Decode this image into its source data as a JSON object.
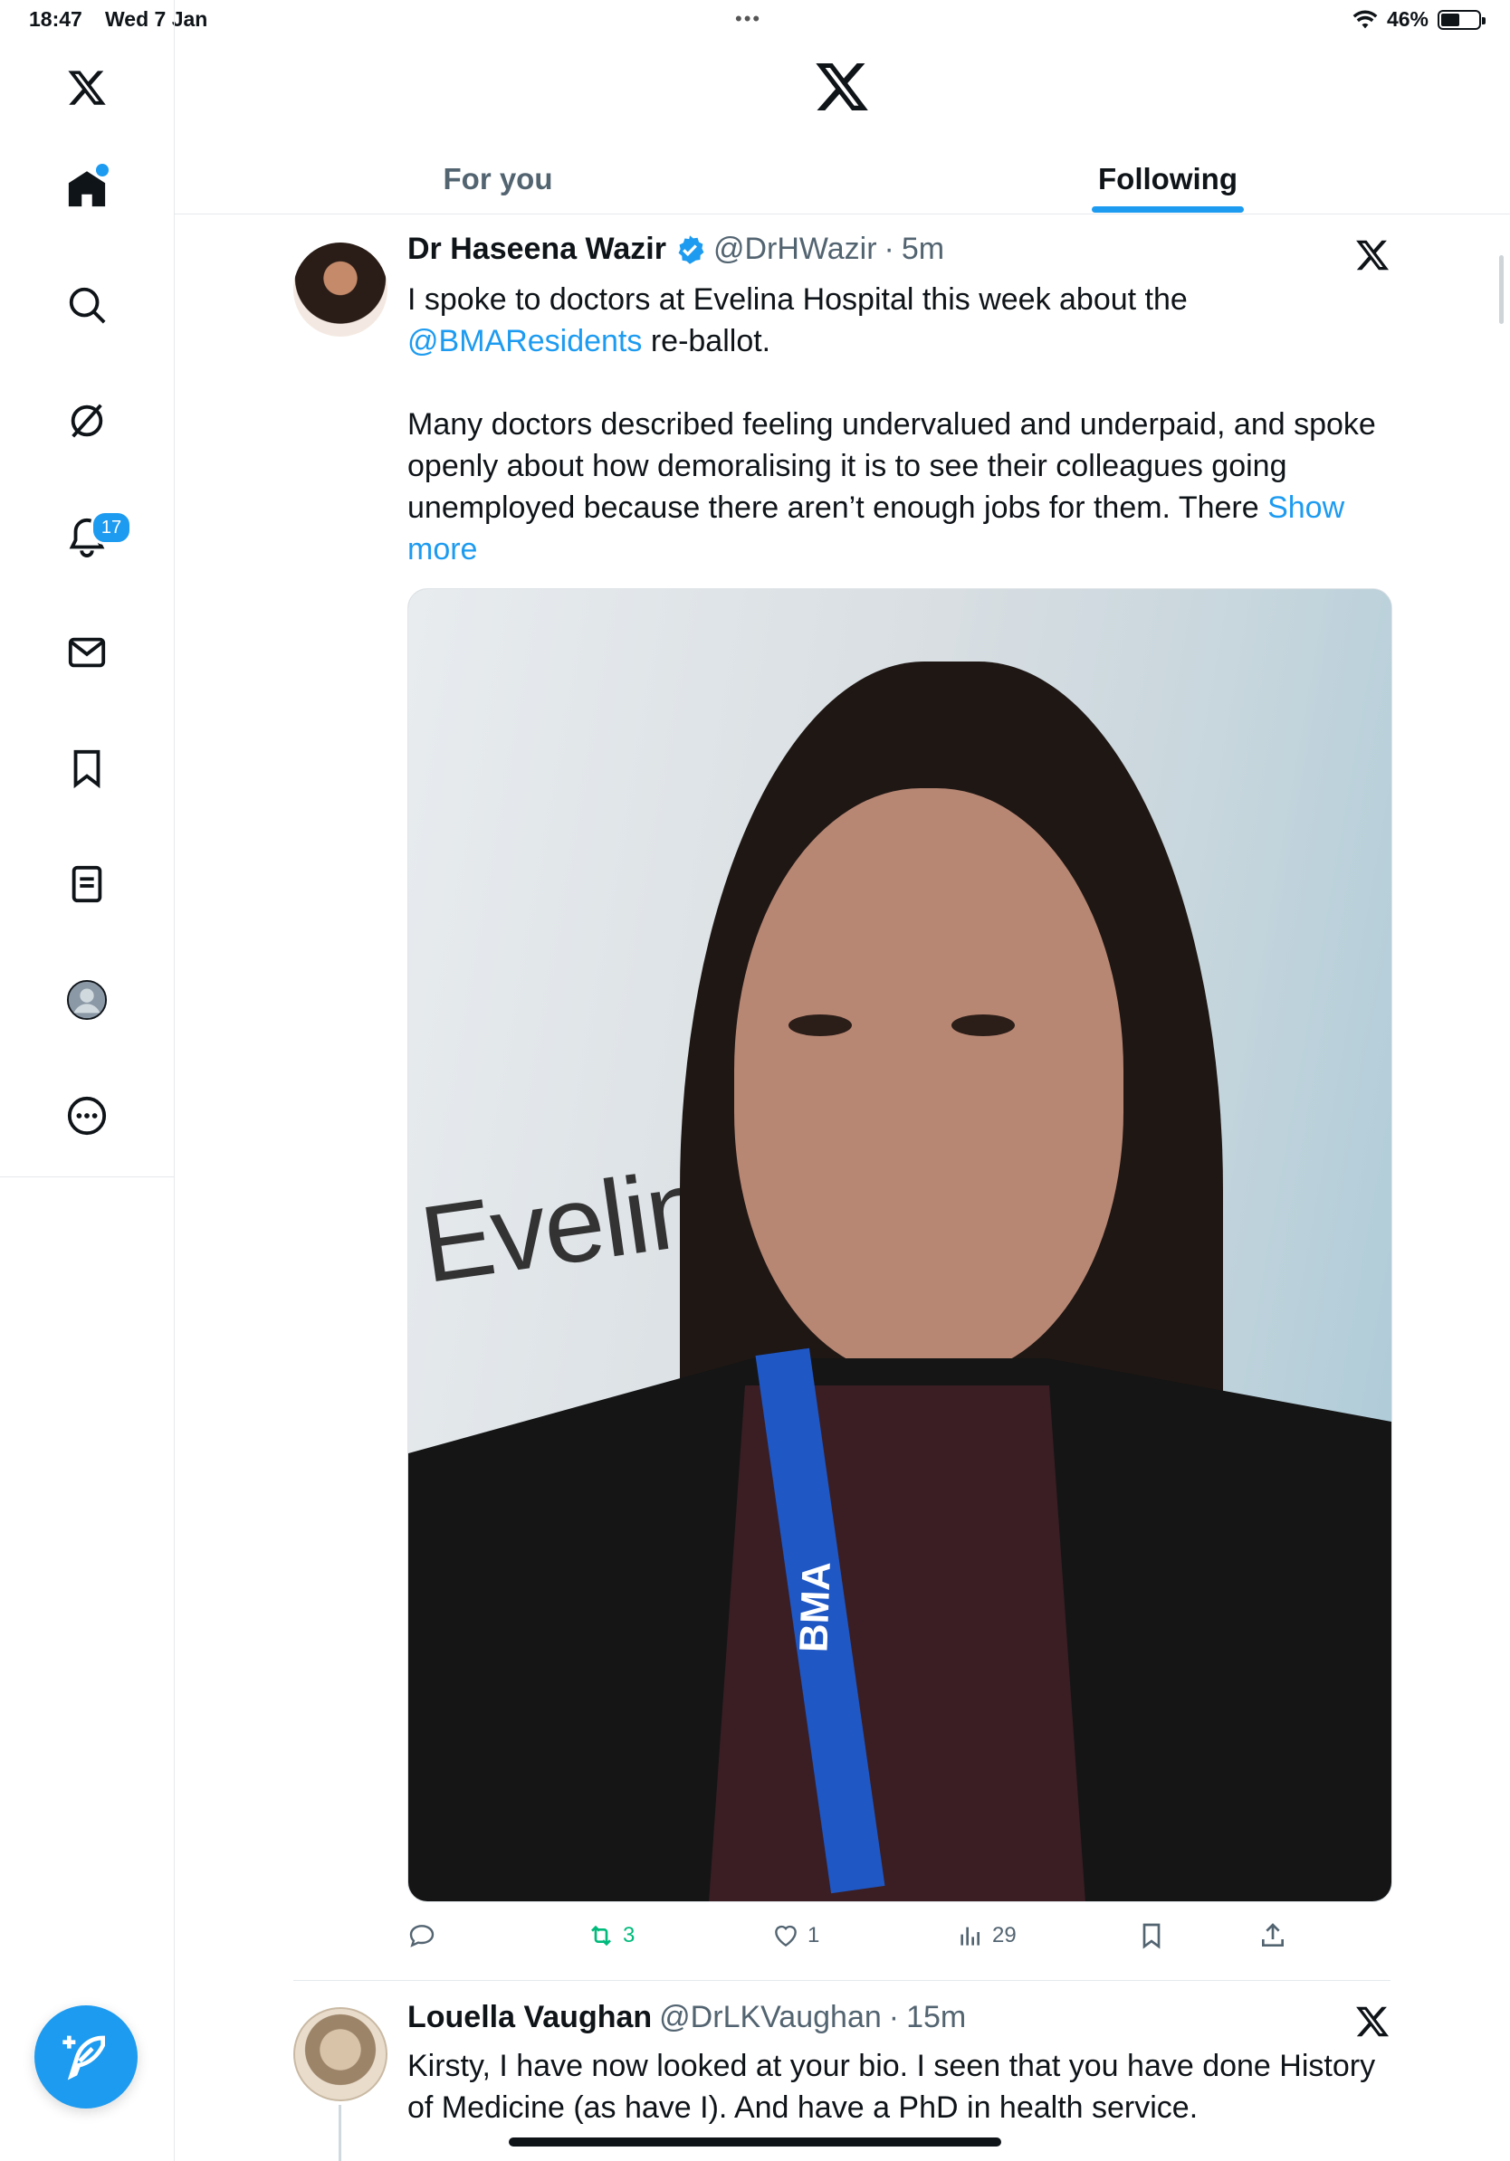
{
  "status_bar": {
    "time": "18:47",
    "date": "Wed 7 Jan",
    "battery": "46%"
  },
  "sidebar": {
    "items": [
      {
        "name": "x-logo"
      },
      {
        "name": "home"
      },
      {
        "name": "search"
      },
      {
        "name": "grok"
      },
      {
        "name": "notifications",
        "badge": "17"
      },
      {
        "name": "messages"
      },
      {
        "name": "bookmarks"
      },
      {
        "name": "lists"
      },
      {
        "name": "profile"
      },
      {
        "name": "more"
      }
    ]
  },
  "header": {
    "tabs": [
      {
        "label": "For you",
        "selected": false
      },
      {
        "label": "Following",
        "selected": true
      }
    ]
  },
  "tweets": [
    {
      "display_name": "Dr Haseena Wazir",
      "verified": true,
      "handle": "@DrHWazir",
      "sep": "·",
      "time": "5m",
      "text_part1": "I spoke to doctors at Evelina Hospital this week about the",
      "mention": "@BMAResidents",
      "text_part2": " re-ballot.",
      "text_para2": "Many doctors described feeling undervalued and underpaid, and spoke openly about how demoralising it is to see their colleagues going unemployed because there aren’t enough jobs for them. There ",
      "show_more": "Show more",
      "media_sign": "Evelina Lond",
      "media_lanyard": "BMA",
      "stats": {
        "replies": "",
        "reposts": "3",
        "likes": "1",
        "views": "29"
      },
      "colors": {
        "repost_active": "#00ba7c"
      }
    },
    {
      "display_name": "Louella Vaughan",
      "handle": "@DrLKVaughan",
      "sep": "·",
      "time": "15m",
      "text": "Kirsty, I have now looked at your bio. I seen that you have done History of Medicine (as have I). And have a PhD in health service."
    }
  ],
  "colors": {
    "accent": "#1d9bf0",
    "text": "#0f1419",
    "muted": "#536471"
  }
}
